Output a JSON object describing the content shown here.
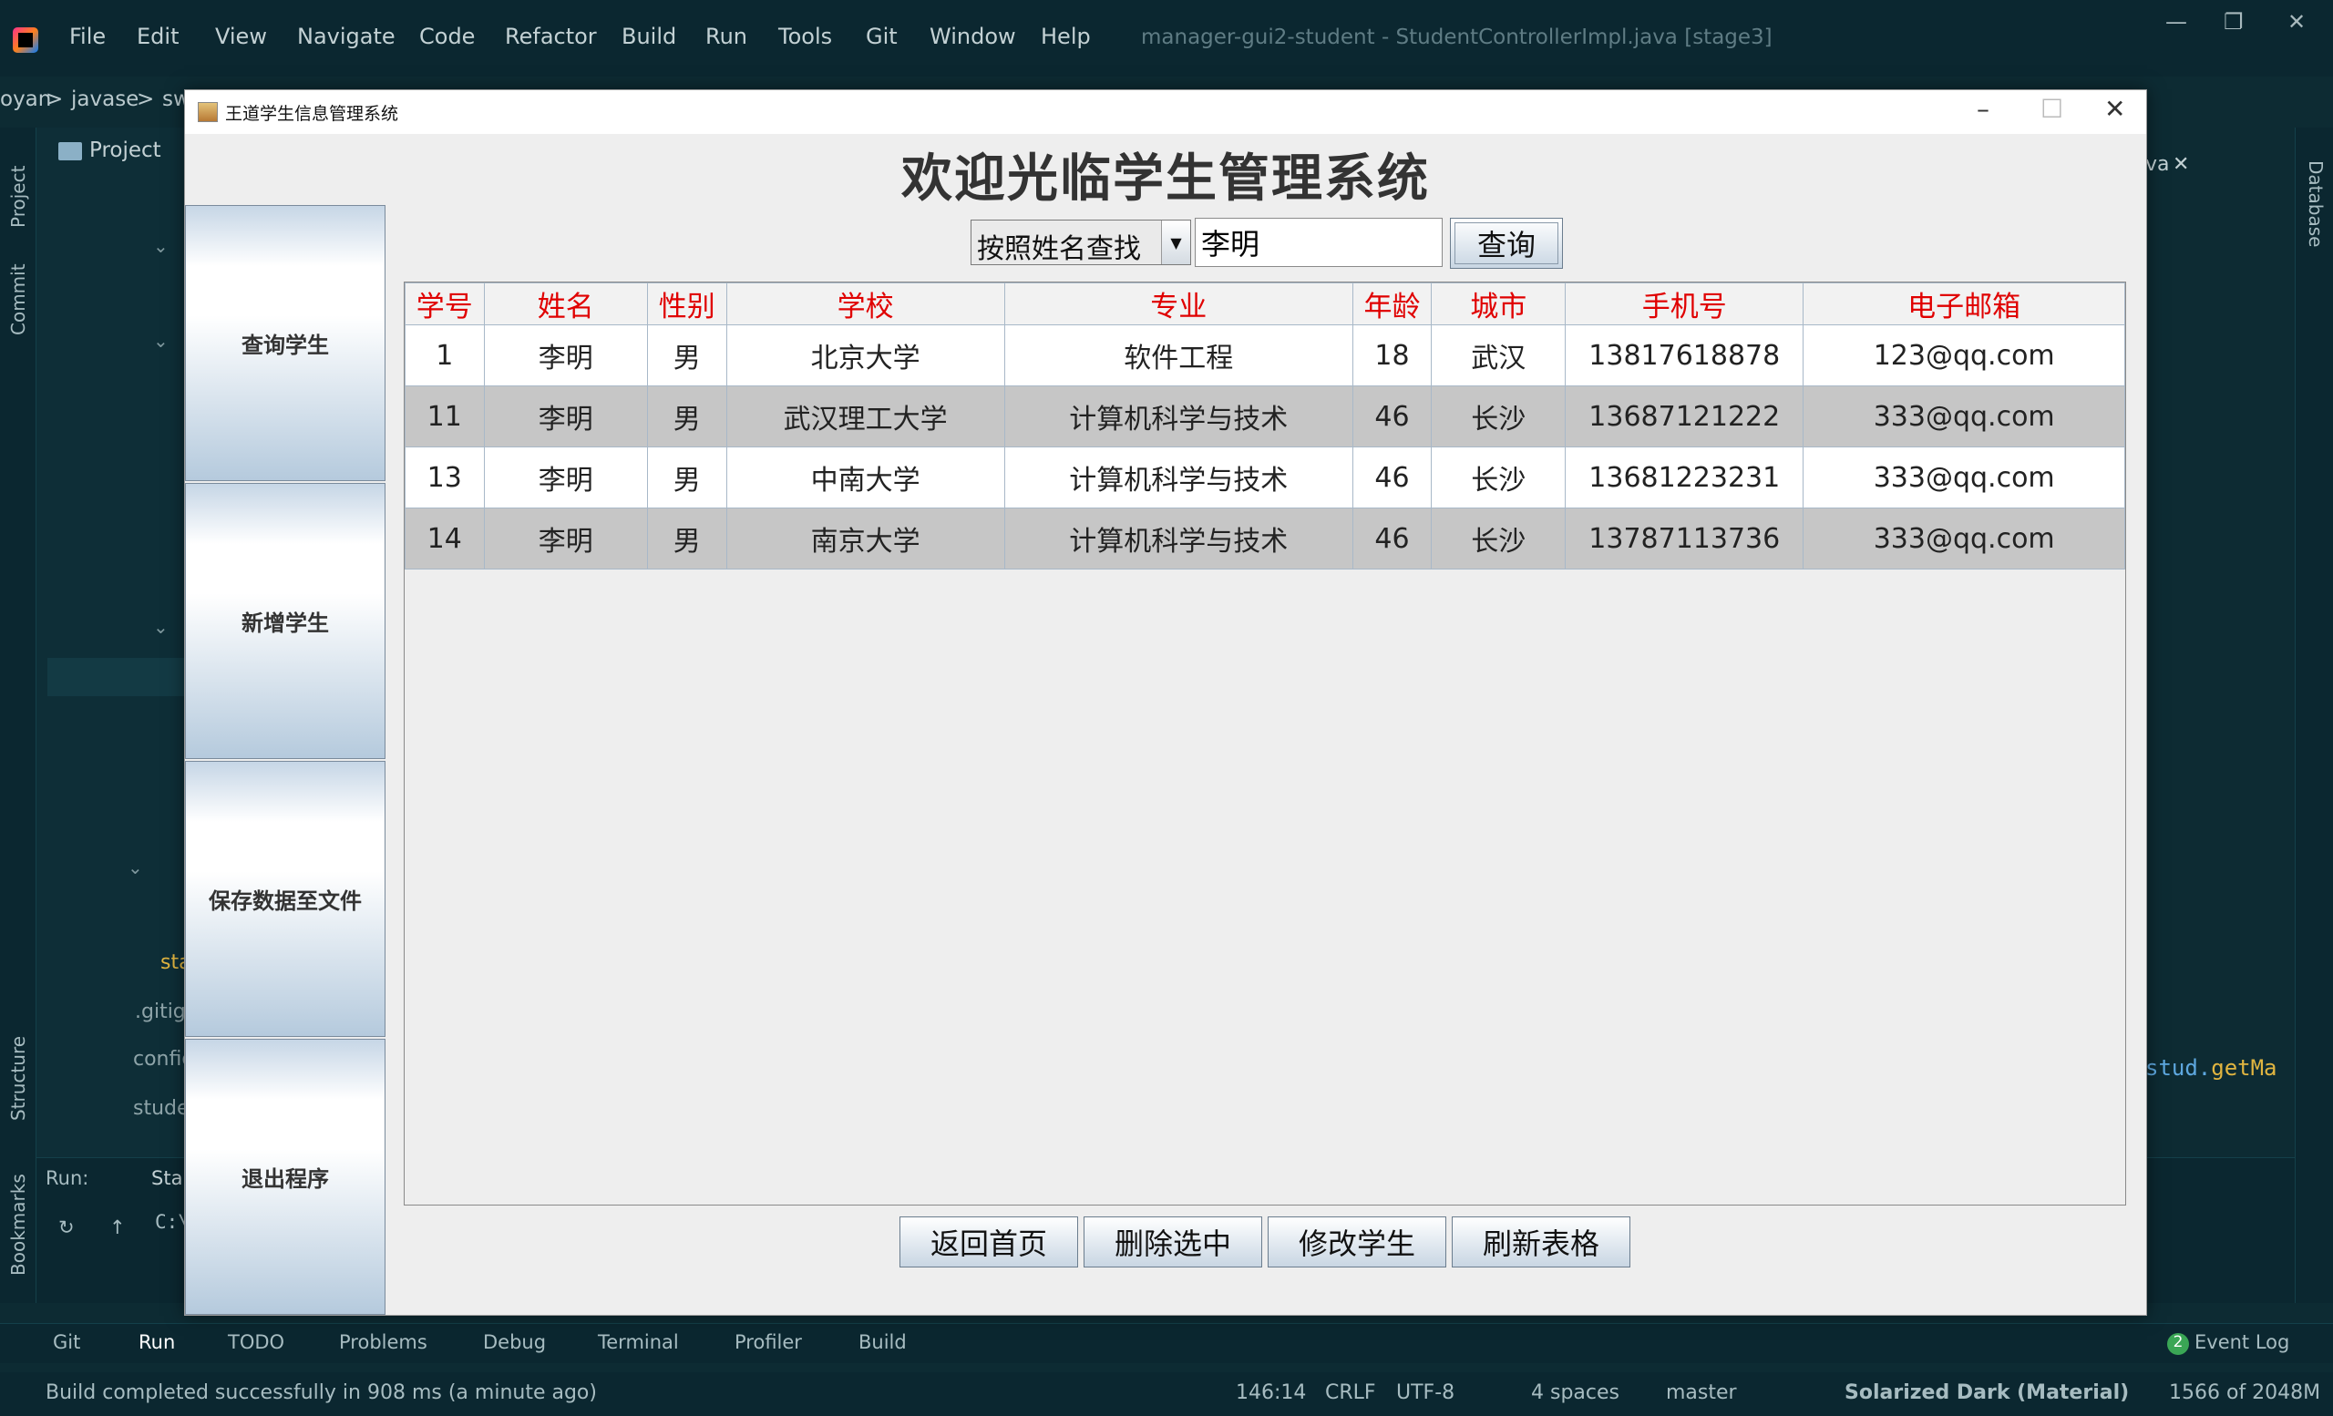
{
  "ide": {
    "menu": [
      "File",
      "Edit",
      "View",
      "Navigate",
      "Code",
      "Refactor",
      "Build",
      "Run",
      "Tools",
      "Git",
      "Window",
      "Help"
    ],
    "title": "manager-gui2-student - StudentControllerImpl.java [stage3]",
    "breadcrumb": [
      "oyan",
      ">",
      "javase",
      ">",
      "sw"
    ],
    "project_label": "Project",
    "left_tools": [
      "Project",
      "Commit",
      "Structure",
      "Bookmarks"
    ],
    "right_tools": [
      "Database"
    ],
    "tree_items": [
      "sta",
      ".gitign",
      "config",
      "stude",
      "stud"
    ],
    "editor_tab_fragment": "va",
    "code_fragment_obj": "stud.",
    "code_fragment_call": "getMa",
    "run": {
      "label": "Run:",
      "tab": "Star",
      "console": "C:\\"
    },
    "bottom_tools": [
      "Git",
      "Run",
      "TODO",
      "Problems",
      "Debug",
      "Terminal",
      "Profiler",
      "Build"
    ],
    "event_log": {
      "count": "2",
      "label": "Event Log"
    },
    "status": {
      "message": "Build completed successfully in 908 ms (a minute ago)",
      "position": "146:14",
      "line_sep": "CRLF",
      "encoding": "UTF-8",
      "indent": "4 spaces",
      "branch": "master",
      "theme": "Solarized Dark (Material)",
      "memory": "1566 of 2048M"
    }
  },
  "app": {
    "window_title": "王道学生信息管理系统",
    "heading": "欢迎光临学生管理系统",
    "side_buttons": [
      "查询学生",
      "新增学生",
      "保存数据至文件",
      "退出程序"
    ],
    "search": {
      "mode": "按照姓名查找",
      "value": "李明",
      "button": "查询"
    },
    "table": {
      "columns": [
        "学号",
        "姓名",
        "性别",
        "学校",
        "专业",
        "年龄",
        "城市",
        "手机号",
        "电子邮箱"
      ],
      "rows": [
        [
          "1",
          "李明",
          "男",
          "北京大学",
          "软件工程",
          "18",
          "武汉",
          "13817618878",
          "123@qq.com"
        ],
        [
          "11",
          "李明",
          "男",
          "武汉理工大学",
          "计算机科学与技术",
          "46",
          "长沙",
          "13687121222",
          "333@qq.com"
        ],
        [
          "13",
          "李明",
          "男",
          "中南大学",
          "计算机科学与技术",
          "46",
          "长沙",
          "13681223231",
          "333@qq.com"
        ],
        [
          "14",
          "李明",
          "男",
          "南京大学",
          "计算机科学与技术",
          "46",
          "长沙",
          "13787113736",
          "333@qq.com"
        ]
      ]
    },
    "bottom_buttons": [
      "返回首页",
      "删除选中",
      "修改学生",
      "刷新表格"
    ]
  },
  "colors": {
    "ide_bg": "#0d2b33",
    "header_text": "#e00000",
    "alt_row": "#c6c6c6"
  }
}
